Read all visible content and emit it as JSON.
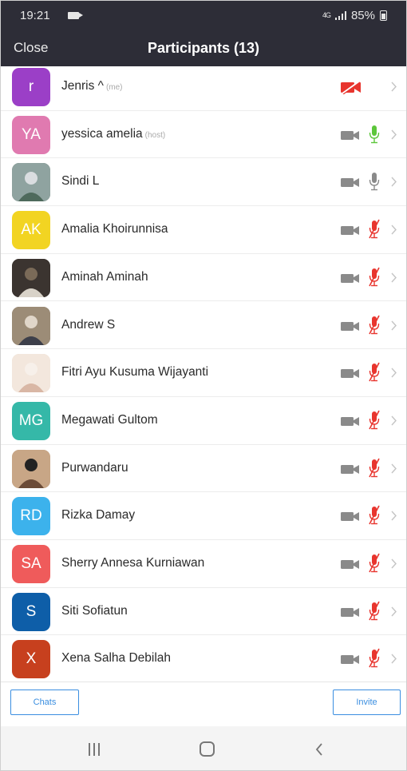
{
  "status_bar": {
    "time": "19:21",
    "network": "4G",
    "battery": "85%",
    "icons": [
      "video-recording-icon",
      "signal-icon",
      "battery-icon"
    ]
  },
  "header": {
    "close_label": "Close",
    "title": "Participants (13)"
  },
  "participants": [
    {
      "name": "Jenris ^",
      "tag": "(me)",
      "initials": "r",
      "avatar_color": "#9b3fc7",
      "video": "off-red",
      "mic": "none"
    },
    {
      "name": "yessica amelia",
      "tag": "(host)",
      "initials": "YA",
      "avatar_color": "#e07ab0",
      "video": "on",
      "mic": "active-green"
    },
    {
      "name": "Sindi L",
      "tag": "",
      "initials": "",
      "avatar_color": "#6b7b6a",
      "video": "on",
      "mic": "on-gray"
    },
    {
      "name": "Amalia Khoirunnisa",
      "tag": "",
      "initials": "AK",
      "avatar_color": "#f2d422",
      "video": "on",
      "mic": "muted"
    },
    {
      "name": "Aminah Aminah",
      "tag": "",
      "initials": "",
      "avatar_color": "#4a4440",
      "video": "on",
      "mic": "muted"
    },
    {
      "name": "Andrew S",
      "tag": "",
      "initials": "",
      "avatar_color": "#7e6b5a",
      "video": "on",
      "mic": "muted"
    },
    {
      "name": "Fitri Ayu Kusuma Wijayanti",
      "tag": "",
      "initials": "",
      "avatar_color": "#e9d7c8",
      "video": "on",
      "mic": "muted"
    },
    {
      "name": "Megawati Gultom",
      "tag": "",
      "initials": "MG",
      "avatar_color": "#35b8a8",
      "video": "on",
      "mic": "muted"
    },
    {
      "name": "Purwandaru",
      "tag": "",
      "initials": "",
      "avatar_color": "#c9a98c",
      "video": "on",
      "mic": "muted"
    },
    {
      "name": "Rizka Damay",
      "tag": "",
      "initials": "RD",
      "avatar_color": "#3cb2ec",
      "video": "on",
      "mic": "muted"
    },
    {
      "name": "Sherry Annesa Kurniawan",
      "tag": "",
      "initials": "SA",
      "avatar_color": "#ef5b5b",
      "video": "on",
      "mic": "muted"
    },
    {
      "name": "Siti Sofiatun",
      "tag": "",
      "initials": "S",
      "avatar_color": "#0e5ea8",
      "video": "on",
      "mic": "muted"
    },
    {
      "name": "Xena Salha Debilah",
      "tag": "",
      "initials": "X",
      "avatar_color": "#c7401e",
      "video": "on",
      "mic": "muted"
    }
  ],
  "footer": {
    "chats_label": "Chats",
    "invite_label": "Invite"
  },
  "nav": {
    "icons": [
      "recent-apps-icon",
      "home-icon",
      "back-icon"
    ]
  },
  "colors": {
    "header_bg": "#2d2d37",
    "muted_red": "#e8352e",
    "mic_green": "#5cc63a",
    "icon_gray": "#8a8a8a",
    "accent_blue": "#3a8ee0"
  }
}
